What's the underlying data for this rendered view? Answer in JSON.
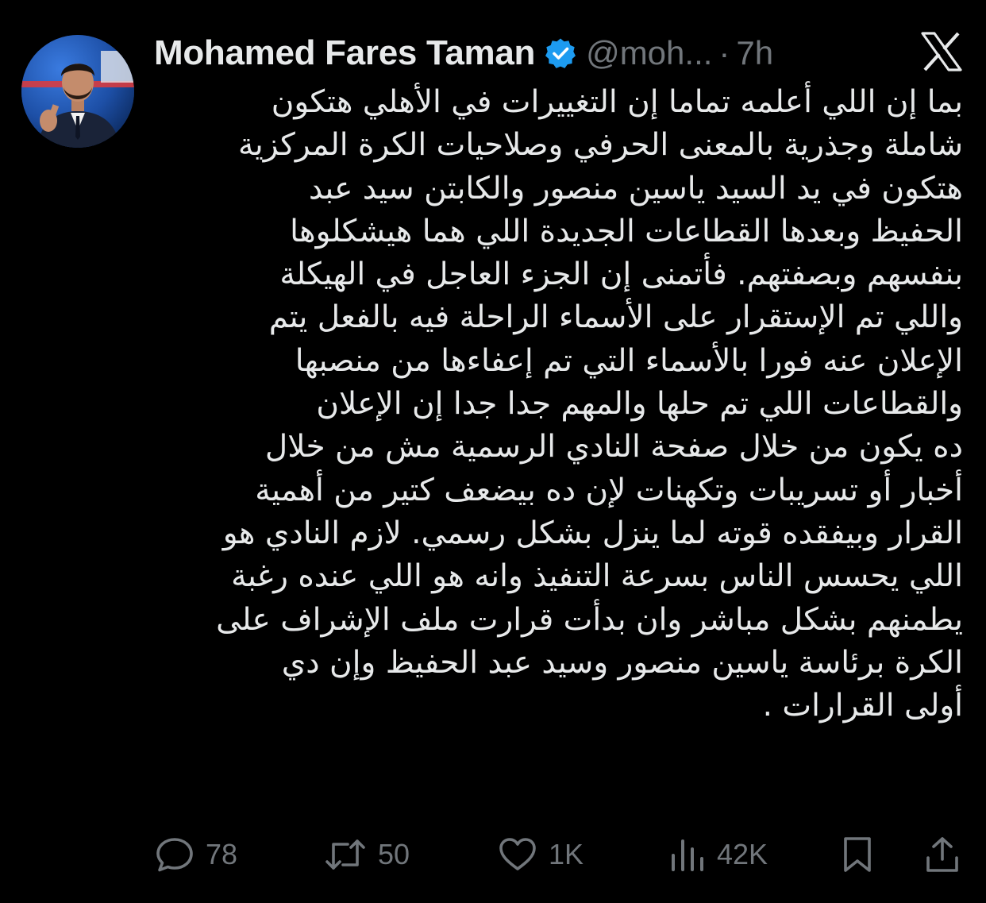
{
  "author": {
    "display_name": "Mohamed Fares Taman",
    "handle": "@moh...",
    "separator": "·",
    "time_ago": "7h"
  },
  "colors": {
    "background": "#000000",
    "text": "#e7e9ea",
    "muted": "#71767b",
    "verified": "#1d9bf0"
  },
  "tweet": {
    "lines": [
      "بما إن اللي أعلمه تماما إن التغييرات في الأهلي هتكون",
      "شاملة وجذرية بالمعنى الحرفي وصلاحيات الكرة المركزية",
      "هتكون في يد السيد ياسين منصور والكابتن سيد عبد",
      "الحفيظ وبعدها القطاعات الجديدة اللي هما هيشكلوها",
      "بنفسهم وبصفتهم. فأتمنى إن الجزء العاجل في الهيكلة",
      "واللي تم الإستقرار على الأسماء الراحلة فيه بالفعل يتم",
      "الإعلان عنه فورا بالأسماء التي تم إعفاءها من منصبها",
      "والقطاعات اللي تم حلها والمهم جدا جدا إن الإعلان",
      "ده يكون من خلال صفحة النادي الرسمية مش من خلال",
      "أخبار أو تسريبات وتكهنات لإن ده بيضعف كتير من أهمية",
      "القرار وبيفقده قوته لما ينزل بشكل رسمي. لازم النادي هو",
      "اللي يحسس الناس بسرعة التنفيذ وانه هو اللي عنده رغبة",
      "يطمنهم بشكل مباشر وان بدأت قرارت ملف الإشراف على",
      "الكرة برئاسة ياسين منصور وسيد عبد الحفيظ وإن دي",
      "أولى القرارات ."
    ]
  },
  "actions": {
    "replies": "78",
    "reposts": "50",
    "likes": "1K",
    "views": "42K"
  },
  "icons": {
    "avatar": "profile-photo",
    "verified": "verified-badge-icon",
    "logo": "x-logo-icon",
    "reply": "reply-icon",
    "repost": "repost-icon",
    "like": "heart-icon",
    "views": "views-icon",
    "bookmark": "bookmark-icon",
    "share": "share-icon"
  }
}
